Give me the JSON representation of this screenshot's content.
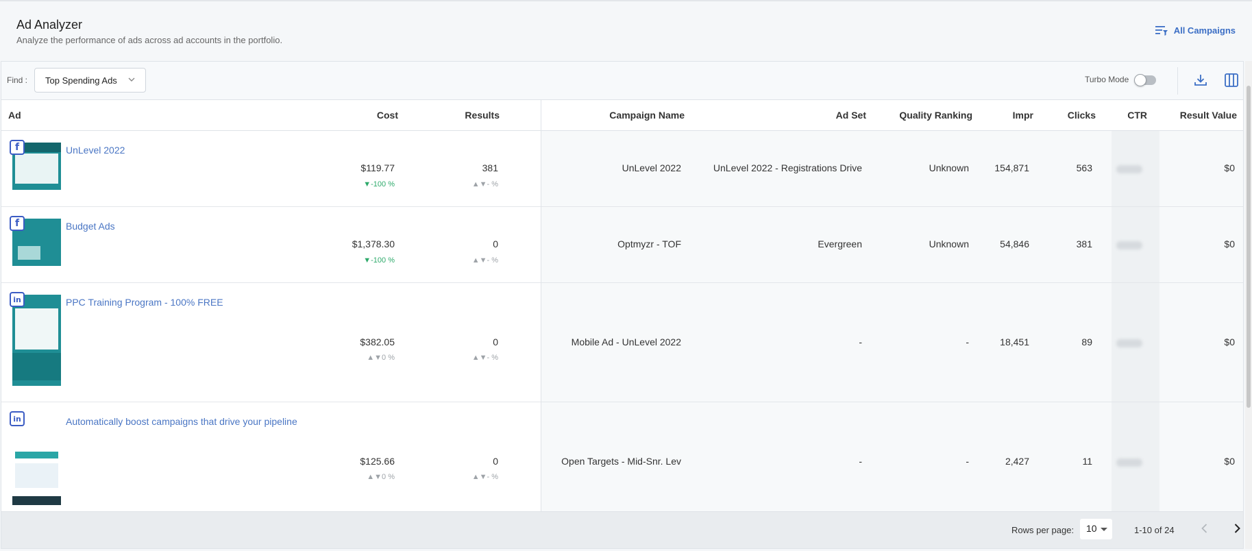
{
  "header": {
    "title": "Ad Analyzer",
    "subtitle": "Analyze the performance of ads across ad accounts in the portfolio.",
    "all_campaigns_label": "All Campaigns",
    "all_campaigns_icon": "filter-list-icon"
  },
  "toolbar": {
    "find_label": "Find :",
    "find_value": "Top Spending Ads",
    "turbo_label": "Turbo Mode",
    "turbo_on": false,
    "download_icon": "download-icon",
    "columns_icon": "columns-icon"
  },
  "columns": {
    "ad": "Ad",
    "cost": "Cost",
    "results": "Results",
    "campaign_name": "Campaign Name",
    "ad_set": "Ad Set",
    "quality_ranking": "Quality Ranking",
    "impr": "Impr",
    "clicks": "Clicks",
    "ctr": "CTR",
    "result_value": "Result Value"
  },
  "rows": [
    {
      "network": "f",
      "network_icon": "facebook-icon",
      "name": "UnLevel 2022",
      "cost": "$119.77",
      "cost_delta": "▼-100 %",
      "results": "381",
      "results_delta": "▲▼- %",
      "campaign": "UnLevel 2022",
      "ad_set": "UnLevel 2022 - Registrations Drive",
      "quality": "Unknown",
      "impr": "154,871",
      "clicks": "563",
      "result_value": "$0"
    },
    {
      "network": "f",
      "network_icon": "facebook-icon",
      "name": "Budget Ads",
      "cost": "$1,378.30",
      "cost_delta": "▼-100 %",
      "results": "0",
      "results_delta": "▲▼- %",
      "campaign": "Optmyzr - TOF",
      "ad_set": "Evergreen",
      "quality": "Unknown",
      "impr": "54,846",
      "clicks": "381",
      "result_value": "$0"
    },
    {
      "network": "in",
      "network_icon": "linkedin-icon",
      "name": "PPC Training Program - 100% FREE",
      "cost": "$382.05",
      "cost_delta": "▲▼0 %",
      "results": "0",
      "results_delta": "▲▼- %",
      "campaign": "Mobile Ad - UnLevel 2022",
      "ad_set": "-",
      "quality": "-",
      "impr": "18,451",
      "clicks": "89",
      "result_value": "$0"
    },
    {
      "network": "in",
      "network_icon": "linkedin-icon",
      "name": "Automatically boost campaigns that drive your pipeline",
      "cost": "$125.66",
      "cost_delta": "▲▼0 %",
      "results": "0",
      "results_delta": "▲▼- %",
      "campaign": "Open Targets - Mid-Snr. Lev",
      "ad_set": "-",
      "quality": "-",
      "impr": "2,427",
      "clicks": "11",
      "result_value": "$0"
    }
  ],
  "footer": {
    "rows_per_page_label": "Rows per page:",
    "rows_per_page_value": "10",
    "range": "1-10 of 24",
    "prev_icon": "chevron-left-icon",
    "next_icon": "chevron-right-icon"
  }
}
